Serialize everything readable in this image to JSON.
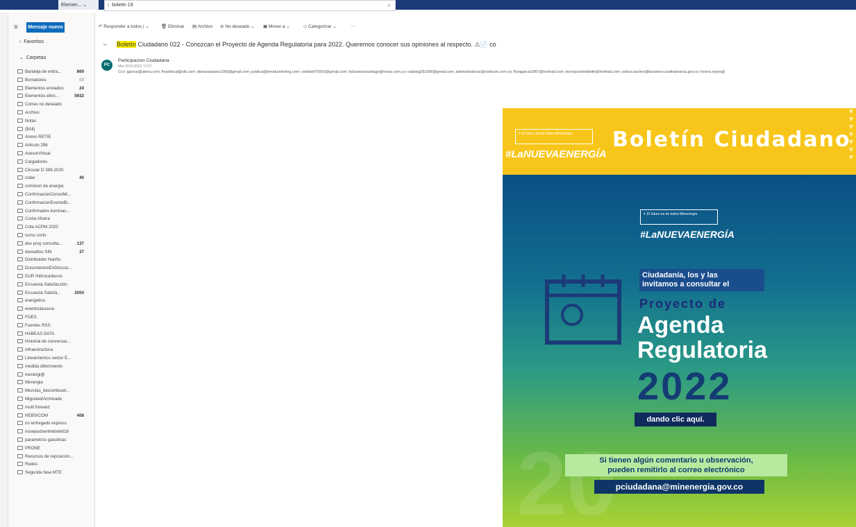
{
  "topbar": {
    "folder_dropdown": "Elemen...",
    "search_value": "boletin 19"
  },
  "sidebar": {
    "new_mail": "Mensaje nuevo",
    "favorites": "Favoritos",
    "folders": "Carpetas",
    "items": [
      {
        "label": "Bandeja de entra...",
        "count": "869",
        "light": false
      },
      {
        "label": "Borradores",
        "count": "59",
        "light": true
      },
      {
        "label": "Elementos enviados",
        "count": "24",
        "light": false
      },
      {
        "label": "Elementos elimi...",
        "count": "5932",
        "light": false
      },
      {
        "label": "Correo no deseado",
        "count": "",
        "light": false
      },
      {
        "label": "Archivo",
        "count": "",
        "light": false
      },
      {
        "label": "Notas",
        "count": "",
        "light": false
      },
      {
        "label": "($All)",
        "count": "",
        "light": false
      },
      {
        "label": "Anexo RETIE",
        "count": "",
        "light": false
      },
      {
        "label": "Articulo 296",
        "count": "",
        "light": false
      },
      {
        "label": "AsesorVirtual",
        "count": "",
        "light": false
      },
      {
        "label": "Cargadores",
        "count": "",
        "light": false
      },
      {
        "label": "Circular D 399-2020",
        "count": "",
        "light": false
      },
      {
        "label": "colas",
        "count": "40",
        "light": false
      },
      {
        "label": "comision de energia",
        "count": "",
        "light": false
      },
      {
        "label": "ConfirmacionConsoMi...",
        "count": "",
        "light": false
      },
      {
        "label": "ConfirmacionEventoBi...",
        "count": "",
        "light": false
      },
      {
        "label": "Confirmados iluminac...",
        "count": "",
        "light": false
      },
      {
        "label": "Costa Afuera",
        "count": "",
        "light": false
      },
      {
        "label": "Crite ACPM 2020",
        "count": "",
        "light": false
      },
      {
        "label": "curso corto",
        "count": "",
        "light": false
      },
      {
        "label": "dev proy consulta...",
        "count": "137",
        "light": false
      },
      {
        "label": "devueltos SIN",
        "count": "37",
        "light": false
      },
      {
        "label": "Distribuidor Nariño",
        "count": "",
        "light": false
      },
      {
        "label": "DocumentosEnDiscusi...",
        "count": "",
        "light": false
      },
      {
        "label": "DUR Hidrocarburos",
        "count": "",
        "light": false
      },
      {
        "label": "Encuesta Satisfacción",
        "count": "",
        "light": false
      },
      {
        "label": "Encuesta Satisfa...",
        "count": "2004",
        "light": false
      },
      {
        "label": "energetico",
        "count": "",
        "light": false
      },
      {
        "label": "eventoclausura",
        "count": "",
        "light": false
      },
      {
        "label": "FOES",
        "count": "",
        "light": false
      },
      {
        "label": "Fuentes RSS",
        "count": "",
        "light": false
      },
      {
        "label": "HABEAS DATA",
        "count": "",
        "light": false
      },
      {
        "label": "Historial de conversac...",
        "count": "",
        "light": false
      },
      {
        "label": "Infraestructura",
        "count": "",
        "light": false
      },
      {
        "label": "Lineamientos sector E...",
        "count": "",
        "light": false
      },
      {
        "label": "medida diferimiento",
        "count": "",
        "light": false
      },
      {
        "label": "menergi@",
        "count": "",
        "light": false
      },
      {
        "label": "Menergia",
        "count": "",
        "light": false
      },
      {
        "label": "Mezclas_biocombusti...",
        "count": "",
        "light": false
      },
      {
        "label": "Migrated/Archivado",
        "count": "",
        "light": false
      },
      {
        "label": "multi forward",
        "count": "",
        "light": false
      },
      {
        "label": "NEBSICOM",
        "count": "408",
        "light": false
      },
      {
        "label": "no entregado express",
        "count": "",
        "light": false
      },
      {
        "label": "nosepudoentreboleti18",
        "count": "",
        "light": false
      },
      {
        "label": "parametros gasolinas",
        "count": "",
        "light": false
      },
      {
        "label": "PRONE",
        "count": "",
        "light": false
      },
      {
        "label": "Recursos de reposición...",
        "count": "",
        "light": false
      },
      {
        "label": "Redes",
        "count": "",
        "light": false
      },
      {
        "label": "Segunda fase MTE",
        "count": "",
        "light": false
      }
    ]
  },
  "toolbar": {
    "reply_all": "Responder a todos",
    "delete": "Eliminar",
    "archive": "Archivo",
    "junk": "No deseado",
    "move": "Mover a",
    "categorize": "Categorizar",
    "more": "···"
  },
  "message": {
    "subject_highlight": "Boletín",
    "subject_rest": " Ciudadano 022 - Conozcan el Proyecto de Agenda Regulatoria para 2022. Queremos conocer sus opiniones al respecto. ⚠📄 co",
    "avatar": "PC",
    "sender": "Participacion Ciudadana",
    "date": "Mar 02/11/2021 13:57",
    "cc": "Cco: jgarcia@uterra.com; finanfiscal@slb.com; dianavasques1365@gmail.com; juridica@terrabunkering.com; cristian870915@gmail.com; facturacioncartago@reuss.com.co; natalicg251099@gmail.com; administrativos@sodicom.com.co; floragarcia2907@hotmail.com; tecnopoolmedellin@hotmail.com; cobrocoactivo@tacalera-cundinamarca.gov.co; lorena.reyes@"
  },
  "banner": {
    "logo_text1": "El futuro",
    "logo_text2": "es de todos",
    "logo_text3": "Minenergía",
    "hashtag": "#LaNUEVAENERGÍA",
    "title": "Boletín Ciudadano",
    "line1": "Ciudadanía, los y las",
    "line2": "invitamos a consultar el",
    "proyecto": "Proyecto de",
    "agenda": "Agenda",
    "regulatoria": "Regulatoria",
    "year": "2022",
    "cta": "dando clic aquí.",
    "comment1": "Si tienen algún comentario u observación,",
    "comment2": "pueden remitirlo al correo electrónico",
    "email": "pciudadana@minenergia.gov.co"
  },
  "colors": {
    "accent": "#0f6cbd",
    "highlight": "#fff100",
    "banner_yellow": "#f8c61a",
    "brand_navy": "#1b3a78"
  }
}
